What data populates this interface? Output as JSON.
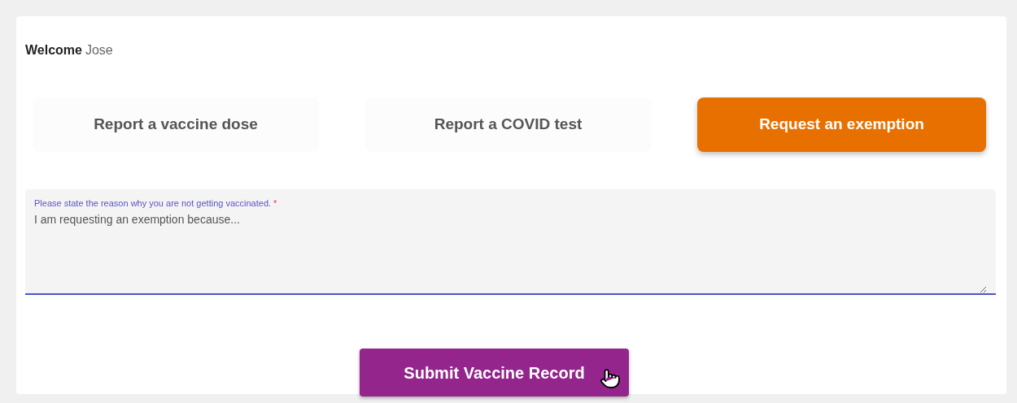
{
  "welcome": {
    "label": "Welcome",
    "name": "Jose"
  },
  "tabs": [
    {
      "label": "Report a vaccine dose",
      "selected": false
    },
    {
      "label": "Report a COVID test",
      "selected": false
    },
    {
      "label": "Request an exemption",
      "selected": true
    }
  ],
  "reason_field": {
    "label": "Please state the reason why you are not getting vaccinated.",
    "required_mark": "*",
    "placeholder": "I am requesting an exemption because..."
  },
  "submit_button": {
    "label": "Submit Vaccine Record"
  }
}
